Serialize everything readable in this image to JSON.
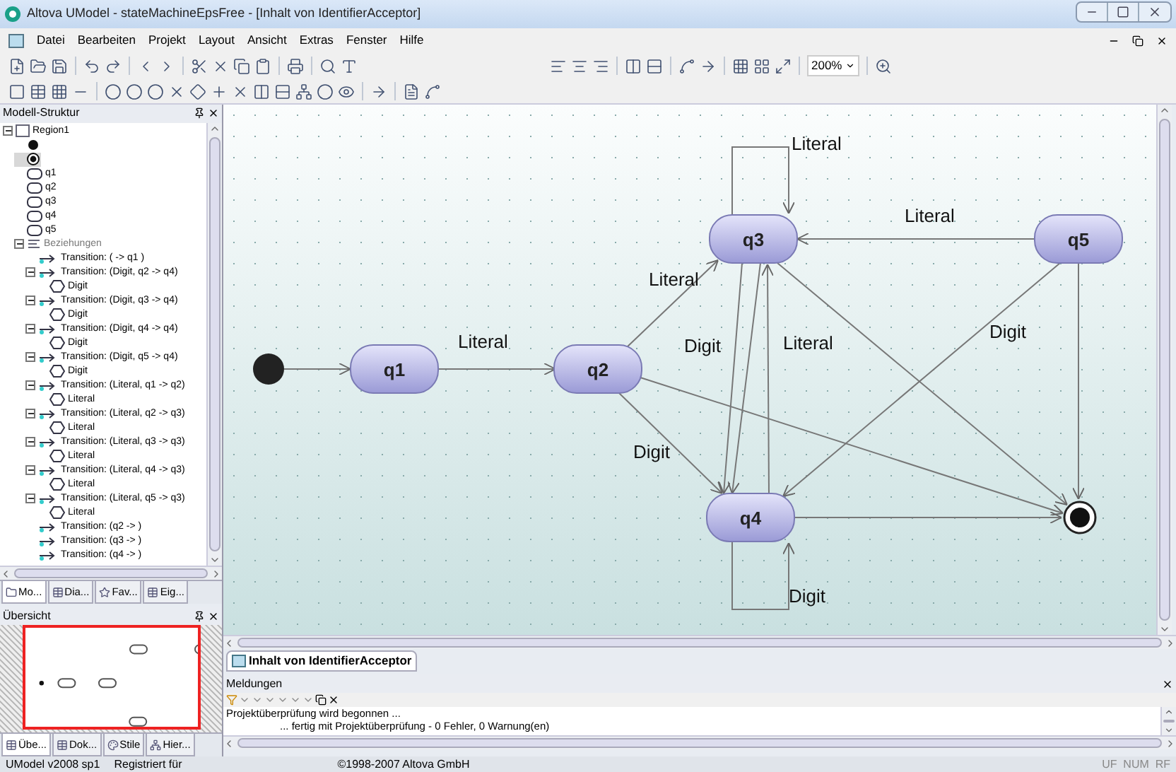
{
  "window": {
    "title": "Altova UModel - stateMachineEpsFree - [Inhalt von IdentifierAcceptor]"
  },
  "menu": [
    "Datei",
    "Bearbeiten",
    "Projekt",
    "Layout",
    "Ansicht",
    "Extras",
    "Fenster",
    "Hilfe"
  ],
  "toolbar": {
    "zoom": "200%"
  },
  "model_tree": {
    "title": "Modell-Struktur",
    "items": [
      {
        "kind": "region",
        "label": "Region1",
        "expanded": true,
        "children": [
          {
            "kind": "initial",
            "selected": false
          },
          {
            "kind": "final",
            "selected": true
          },
          {
            "kind": "state",
            "label": "q1"
          },
          {
            "kind": "state",
            "label": "q2"
          },
          {
            "kind": "state",
            "label": "q3"
          },
          {
            "kind": "state",
            "label": "q4"
          },
          {
            "kind": "state",
            "label": "q5"
          },
          {
            "kind": "group",
            "label": "Beziehungen",
            "expanded": true,
            "children": [
              {
                "kind": "transition",
                "label": "Transition:  ( -> q1 )"
              },
              {
                "kind": "transition",
                "label": "Transition:  (Digit, q2 -> q4)",
                "expanded": true,
                "children": [
                  {
                    "kind": "trigger",
                    "label": "Digit"
                  }
                ]
              },
              {
                "kind": "transition",
                "label": "Transition:  (Digit, q3 -> q4)",
                "expanded": true,
                "children": [
                  {
                    "kind": "trigger",
                    "label": "Digit"
                  }
                ]
              },
              {
                "kind": "transition",
                "label": "Transition:  (Digit, q4 -> q4)",
                "expanded": true,
                "children": [
                  {
                    "kind": "trigger",
                    "label": "Digit"
                  }
                ]
              },
              {
                "kind": "transition",
                "label": "Transition:  (Digit, q5 -> q4)",
                "expanded": true,
                "children": [
                  {
                    "kind": "trigger",
                    "label": "Digit"
                  }
                ]
              },
              {
                "kind": "transition",
                "label": "Transition:  (Literal, q1 -> q2)",
                "expanded": true,
                "children": [
                  {
                    "kind": "trigger",
                    "label": "Literal"
                  }
                ]
              },
              {
                "kind": "transition",
                "label": "Transition:  (Literal, q2 -> q3)",
                "expanded": true,
                "children": [
                  {
                    "kind": "trigger",
                    "label": "Literal"
                  }
                ]
              },
              {
                "kind": "transition",
                "label": "Transition:  (Literal, q3 -> q3)",
                "expanded": true,
                "children": [
                  {
                    "kind": "trigger",
                    "label": "Literal"
                  }
                ]
              },
              {
                "kind": "transition",
                "label": "Transition:  (Literal, q4 -> q3)",
                "expanded": true,
                "children": [
                  {
                    "kind": "trigger",
                    "label": "Literal"
                  }
                ]
              },
              {
                "kind": "transition",
                "label": "Transition:  (Literal, q5 -> q3)",
                "expanded": true,
                "children": [
                  {
                    "kind": "trigger",
                    "label": "Literal"
                  }
                ]
              },
              {
                "kind": "transition",
                "label": "Transition:  (q2 -> )"
              },
              {
                "kind": "transition",
                "label": "Transition:  (q3 -> )"
              },
              {
                "kind": "transition",
                "label": "Transition:  (q4 -> )"
              }
            ]
          }
        ]
      }
    ]
  },
  "left_tabs": [
    {
      "label": "Mo...",
      "selected": true
    },
    {
      "label": "Dia...",
      "selected": false
    },
    {
      "label": "Fav...",
      "selected": false
    },
    {
      "label": "Eig...",
      "selected": false
    }
  ],
  "overview": {
    "title": "Übersicht"
  },
  "overview_tabs": [
    {
      "label": "Übe...",
      "selected": true
    },
    {
      "label": "Dok...",
      "selected": false
    },
    {
      "label": "Stile",
      "selected": false
    },
    {
      "label": "Hier...",
      "selected": false
    }
  ],
  "diagram": {
    "nodes": [
      {
        "kind": "initial"
      },
      {
        "kind": "state",
        "name": "q1"
      },
      {
        "kind": "state",
        "name": "q2"
      },
      {
        "kind": "state",
        "name": "q3"
      },
      {
        "kind": "state",
        "name": "q4"
      },
      {
        "kind": "state",
        "name": "q5"
      },
      {
        "kind": "final"
      }
    ],
    "edges": [
      {
        "label": "Literal"
      },
      {
        "label": "Literal"
      },
      {
        "label": "Literal"
      },
      {
        "label": "Literal"
      },
      {
        "label": "Digit"
      },
      {
        "label": "Literal"
      },
      {
        "label": "Digit"
      },
      {
        "label": "Digit"
      },
      {
        "label": "Digit"
      }
    ]
  },
  "diagram_tabs": [
    {
      "label": "Inhalt von IdentifierAcceptor",
      "selected": true
    }
  ],
  "messages": {
    "title": "Meldungen",
    "lines": [
      "Projektüberprüfung wird begonnen ...",
      "... fertig mit Projektüberprüfung - 0 Fehler, 0 Warnung(en)"
    ]
  },
  "status_bar": {
    "version": "UModel v2008 sp1",
    "registered": "Registriert für",
    "copyright": "©1998-2007 Altova GmbH",
    "indicators": "UF  NUM  RF"
  }
}
